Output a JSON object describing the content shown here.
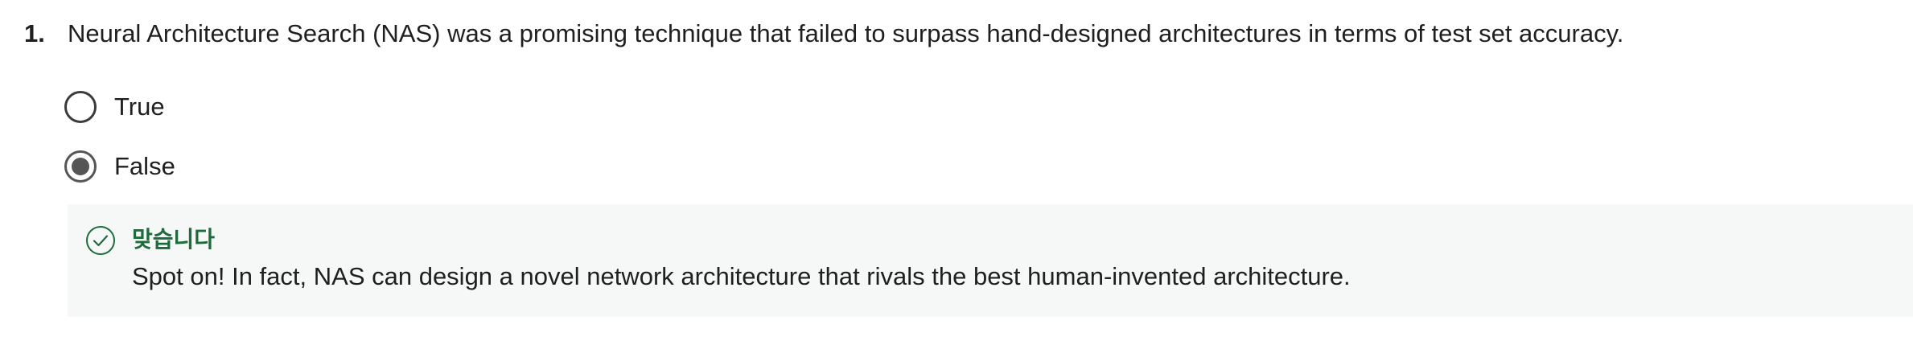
{
  "question": {
    "number": "1.",
    "text": "Neural Architecture Search (NAS) was a promising technique that failed to surpass hand-designed architectures in terms of test set accuracy."
  },
  "options": [
    {
      "label": "True",
      "selected": false
    },
    {
      "label": "False",
      "selected": true
    }
  ],
  "feedback": {
    "status": "맞습니다",
    "icon": "check-circle-icon",
    "message": "Spot on! In fact, NAS can design a novel network architecture that rivals the best human-invented architecture.",
    "status_color": "#1e6b3c",
    "background": "#f5f8f6"
  }
}
